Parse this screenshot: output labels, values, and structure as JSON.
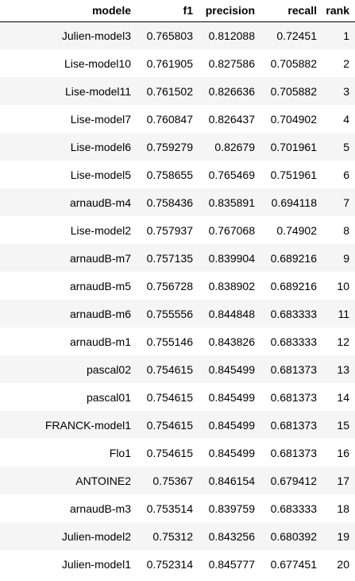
{
  "table": {
    "columns": [
      "modele",
      "f1",
      "precision",
      "recall",
      "rank"
    ],
    "rows": [
      [
        "Julien-model3",
        "0.765803",
        "0.812088",
        "0.72451",
        "1"
      ],
      [
        "Lise-model10",
        "0.761905",
        "0.827586",
        "0.705882",
        "2"
      ],
      [
        "Lise-model11",
        "0.761502",
        "0.826636",
        "0.705882",
        "3"
      ],
      [
        "Lise-model7",
        "0.760847",
        "0.826437",
        "0.704902",
        "4"
      ],
      [
        "Lise-model6",
        "0.759279",
        "0.82679",
        "0.701961",
        "5"
      ],
      [
        "Lise-model5",
        "0.758655",
        "0.765469",
        "0.751961",
        "6"
      ],
      [
        "arnaudB-m4",
        "0.758436",
        "0.835891",
        "0.694118",
        "7"
      ],
      [
        "Lise-model2",
        "0.757937",
        "0.767068",
        "0.74902",
        "8"
      ],
      [
        "arnaudB-m7",
        "0.757135",
        "0.839904",
        "0.689216",
        "9"
      ],
      [
        "arnaudB-m5",
        "0.756728",
        "0.838902",
        "0.689216",
        "10"
      ],
      [
        "arnaudB-m6",
        "0.755556",
        "0.844848",
        "0.683333",
        "11"
      ],
      [
        "arnaudB-m1",
        "0.755146",
        "0.843826",
        "0.683333",
        "12"
      ],
      [
        "pascal02",
        "0.754615",
        "0.845499",
        "0.681373",
        "13"
      ],
      [
        "pascal01",
        "0.754615",
        "0.845499",
        "0.681373",
        "14"
      ],
      [
        "FRANCK-model1",
        "0.754615",
        "0.845499",
        "0.681373",
        "15"
      ],
      [
        "Flo1",
        "0.754615",
        "0.845499",
        "0.681373",
        "16"
      ],
      [
        "ANTOINE2",
        "0.75367",
        "0.846154",
        "0.679412",
        "17"
      ],
      [
        "arnaudB-m3",
        "0.753514",
        "0.839759",
        "0.683333",
        "18"
      ],
      [
        "Julien-model2",
        "0.75312",
        "0.843256",
        "0.680392",
        "19"
      ],
      [
        "Julien-model1",
        "0.752314",
        "0.845777",
        "0.677451",
        "20"
      ]
    ]
  },
  "colors": {
    "header_border": "#000000",
    "row_odd": "#f5f5f5",
    "row_even": "#ffffff",
    "row_hover": "#e1f0fb",
    "text": "#000000"
  }
}
